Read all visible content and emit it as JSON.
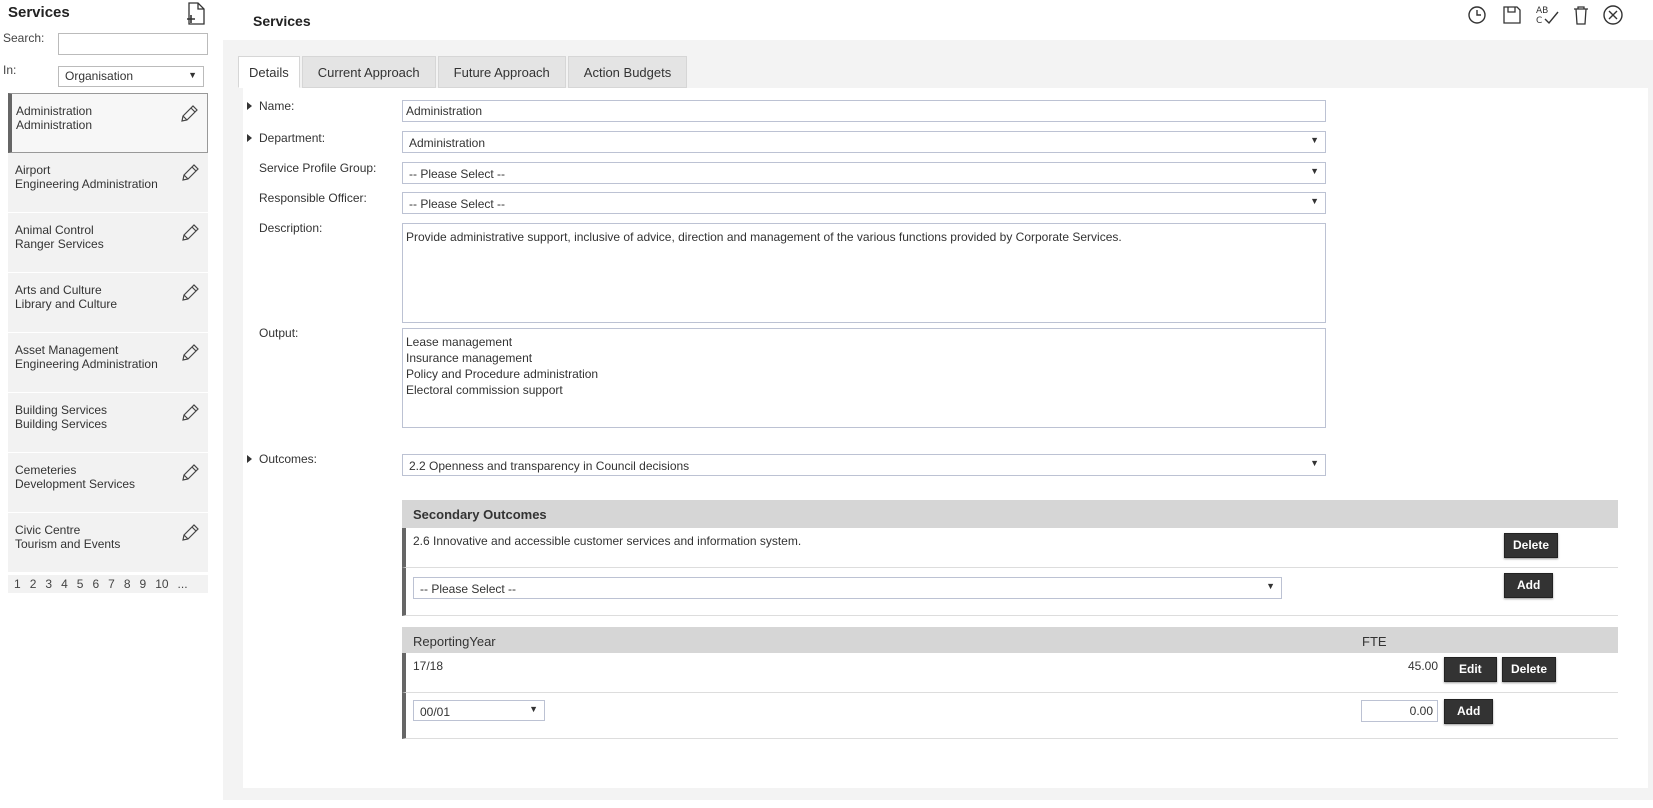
{
  "sidebar": {
    "title": "Services",
    "search_label": "Search:",
    "search_value": "",
    "in_label": "In:",
    "in_value": "Organisation",
    "items": [
      {
        "name": "Administration",
        "dept": "Administration"
      },
      {
        "name": "Airport",
        "dept": "Engineering Administration"
      },
      {
        "name": "Animal Control",
        "dept": "Ranger Services"
      },
      {
        "name": "Arts and Culture",
        "dept": "Library and Culture"
      },
      {
        "name": "Asset Management",
        "dept": "Engineering Administration"
      },
      {
        "name": "Building Services",
        "dept": "Building Services"
      },
      {
        "name": "Cemeteries",
        "dept": "Development Services"
      },
      {
        "name": "Civic Centre",
        "dept": "Tourism and Events"
      }
    ],
    "pages": [
      "1",
      "2",
      "3",
      "4",
      "5",
      "6",
      "7",
      "8",
      "9",
      "10",
      "..."
    ]
  },
  "header": {
    "title": "Services"
  },
  "toolbar": [
    "history-icon",
    "save-icon",
    "spellcheck-icon",
    "delete-icon",
    "close-icon"
  ],
  "tabs": [
    "Details",
    "Current Approach",
    "Future Approach",
    "Action Budgets"
  ],
  "form": {
    "name_label": "Name:",
    "name_value": "Administration",
    "department_label": "Department:",
    "department_value": "Administration",
    "profile_group_label": "Service Profile Group:",
    "profile_group_value": "-- Please Select --",
    "officer_label": "Responsible Officer:",
    "officer_value": "-- Please Select --",
    "description_label": "Description:",
    "description_value": "Provide administrative support, inclusive of advice, direction and management of the various functions provided by Corporate Services.",
    "output_label": "Output:",
    "output_lines": [
      "Lease management",
      "Insurance management",
      "Policy and Procedure administration",
      "Electoral commission support"
    ],
    "outcomes_label": "Outcomes:",
    "outcomes_value": "2.2 Openness and transparency in Council decisions"
  },
  "secondary": {
    "header": "Secondary Outcomes",
    "row_text": "2.6 Innovative and accessible customer services and information system.",
    "delete_label": "Delete",
    "select_value": "-- Please Select --",
    "add_label": "Add"
  },
  "fte": {
    "col_year": "ReportingYear",
    "col_fte": "FTE",
    "row_year": "17/18",
    "row_fte": "45.00",
    "edit_label": "Edit",
    "delete_label": "Delete",
    "new_year": "00/01",
    "new_fte": "0.00",
    "add_label": "Add"
  }
}
